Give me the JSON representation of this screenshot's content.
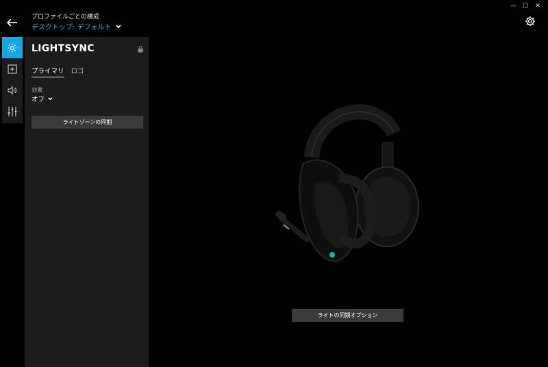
{
  "window": {
    "min": "—",
    "max": "☐",
    "close": "✕"
  },
  "header": {
    "title": "プロファイルごとの構成",
    "profile": "デスクトップ: デフォルト"
  },
  "rail": [
    {
      "name": "lighting",
      "icon": "sun-icon",
      "active": true
    },
    {
      "name": "assignments",
      "icon": "plus-box-icon",
      "active": false
    },
    {
      "name": "sound",
      "icon": "speaker-icon",
      "active": false
    },
    {
      "name": "equalizer",
      "icon": "sliders-icon",
      "active": false
    }
  ],
  "panel": {
    "title": "LIGHTSYNC",
    "tabs": [
      {
        "label": "プライマリ",
        "active": true
      },
      {
        "label": "ロゴ",
        "active": false
      }
    ],
    "effect_label": "効果",
    "effect_value": "オフ",
    "sync_button": "ライトゾーンの同期"
  },
  "main": {
    "device_icon": "headset-image",
    "sync_options_button": "ライトの同期オプション"
  },
  "colors": {
    "accent": "#17a6e4",
    "link": "#2ba8e0",
    "panel": "#1c1c1c",
    "button": "#3a3a3a"
  }
}
